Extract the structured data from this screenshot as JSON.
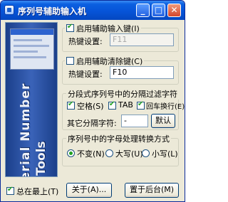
{
  "window": {
    "title": "序列号辅助输入机",
    "minimize_glyph": "_",
    "maximize_glyph": "□",
    "close_glyph": "✕"
  },
  "banner": {
    "line1": "Serial Number",
    "line2": "Tools"
  },
  "group_input": {
    "checkbox_label": "启用辅助输入键(I)",
    "checked": true,
    "hotkey_label": "热键设置:",
    "hotkey_value": "F11"
  },
  "group_clear": {
    "checkbox_label": "启用辅助清除键(C)",
    "checked": false,
    "hotkey_label": "热键设置:",
    "hotkey_value": "F10"
  },
  "group_separator": {
    "title": "分段式序列号中的分隔过滤字符",
    "options": [
      {
        "label": "空格(S)",
        "checked": true
      },
      {
        "label": "TAB",
        "checked": true
      },
      {
        "label": "回车换行(E)",
        "checked": true
      }
    ],
    "other_label": "其它分隔字符:",
    "other_value": "-",
    "default_button": "默认"
  },
  "group_case": {
    "title": "序列号中的字母处理转换方式",
    "options": [
      {
        "label": "不变(N)",
        "selected": true
      },
      {
        "label": "大写(U)",
        "selected": false
      },
      {
        "label": "小写(L)",
        "selected": false
      }
    ]
  },
  "bottom": {
    "always_on_top_label": "总在最上(T)",
    "always_on_top_checked": true,
    "about_button": "关于(A)...",
    "background_button": "置于后台(M)"
  }
}
